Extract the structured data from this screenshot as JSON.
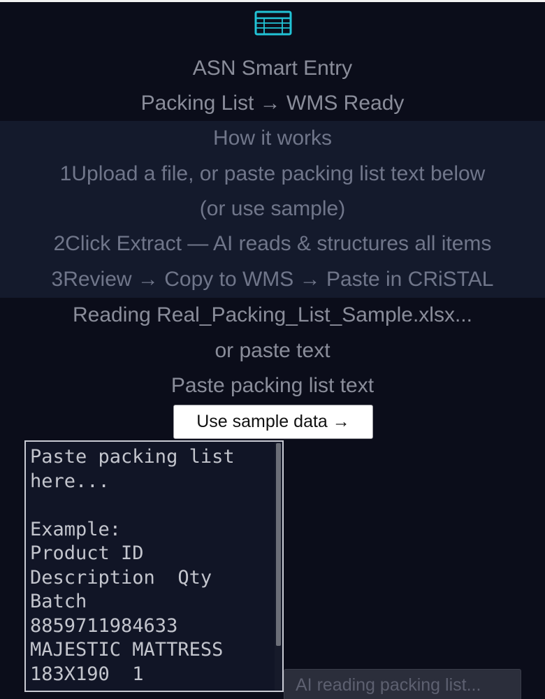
{
  "header": {
    "logo_icon": "table-icon",
    "accent_color": "#22c3d6",
    "title": "ASN Smart Entry",
    "subtitle": "Packing List → WMS Ready"
  },
  "how_it_works": {
    "heading": "How it works",
    "steps": [
      {
        "number": "1",
        "text_line1": "Upload a file, or paste packing list text below",
        "text_line2": "(or use sample)"
      },
      {
        "number": "2",
        "text": "Click Extract — AI reads & structures all items"
      },
      {
        "number": "3",
        "text": "Review → Copy to WMS → Paste in CRiSTAL"
      }
    ]
  },
  "upload": {
    "status": "Reading Real_Packing_List_Sample.xlsx...",
    "or_label": "or paste text",
    "paste_label": "Paste packing list text",
    "sample_button_label": "Use sample data →"
  },
  "paste_area": {
    "value": "",
    "placeholder": "Paste packing list\nhere...\n\nExample:\nProduct ID\nDescription  Qty\nBatch\n8859711984633\nMAJESTIC MATTRESS\n183X190  1"
  },
  "extract": {
    "button_label": "AI reading packing list..."
  }
}
